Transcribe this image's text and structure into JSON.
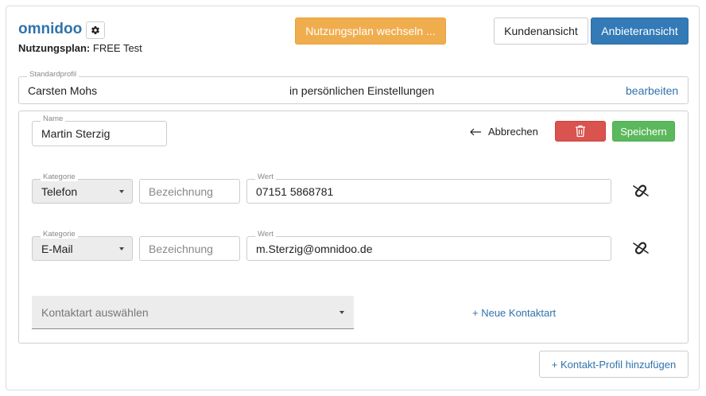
{
  "header": {
    "brand": "omnidoo",
    "plan_label": "Nutzungsplan:",
    "plan_value": "FREE Test",
    "change_plan_button": "Nutzungsplan wechseln ...",
    "customer_view_button": "Kundenansicht",
    "provider_view_button": "Anbieteransicht"
  },
  "standard_profile": {
    "legend": "Standardprofil",
    "name": "Carsten Mohs",
    "hint": "in persönlichen Einstellungen",
    "edit_link": "bearbeiten"
  },
  "profile": {
    "name_legend": "Name",
    "name_value": "Martin Sterzig",
    "cancel_label": "Abbrechen",
    "save_label": "Speichern",
    "contacts": [
      {
        "category_legend": "Kategorie",
        "category": "Telefon",
        "designation_placeholder": "Bezeichnung",
        "value_legend": "Wert",
        "value": "07151 5868781"
      },
      {
        "category_legend": "Kategorie",
        "category": "E-Mail",
        "designation_placeholder": "Bezeichnung",
        "value_legend": "Wert",
        "value": "m.Sterzig@omnidoo.de"
      }
    ],
    "contact_type_placeholder": "Kontaktart auswählen",
    "new_contact_type_link": "+ Neue Kontaktart"
  },
  "add_profile_button": "+ Kontakt-Profil hinzufügen",
  "colors": {
    "primary": "#337ab7",
    "warning": "#f0ad4e",
    "danger": "#d9534f",
    "success": "#5cb85c",
    "link": "#2f73ad"
  },
  "icons": [
    "gear-icon",
    "arrow-left-icon",
    "trash-icon",
    "unlink-icon",
    "caret-down-icon"
  ]
}
